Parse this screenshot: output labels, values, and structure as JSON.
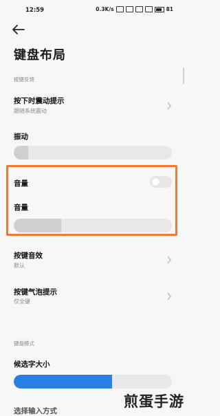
{
  "status": {
    "time": "12:59",
    "speed": "0.3K/s",
    "battery": "81"
  },
  "page": {
    "title": "键盘布局"
  },
  "sections": {
    "feedback_label": "按键反馈",
    "keyboard_mode_label": "键盘模式"
  },
  "rows": {
    "vibrate_hint": {
      "title": "按下时震动提示",
      "sub": "跟随系统震动"
    },
    "vibration": {
      "title": "振动",
      "level": 0.09
    },
    "volume_toggle": {
      "title": "音量",
      "on": false
    },
    "volume": {
      "title": "音量",
      "level": 0.3
    },
    "key_sound": {
      "title": "按键音效",
      "sub": "默认"
    },
    "bubble_hint": {
      "title": "按键气泡提示",
      "sub": "仅全键"
    },
    "candidate_size": {
      "title": "候选字大小",
      "level": 0.62
    },
    "input_method": {
      "title": "选择输入方式"
    }
  },
  "colors": {
    "accent": "#2a7fe3",
    "slider_fill": "#cfcfcf",
    "highlight": "#f07a34"
  },
  "icons": {
    "back": "back-arrow-icon",
    "chevron": "chevron-right-icon"
  },
  "watermark": "煎蛋手游"
}
